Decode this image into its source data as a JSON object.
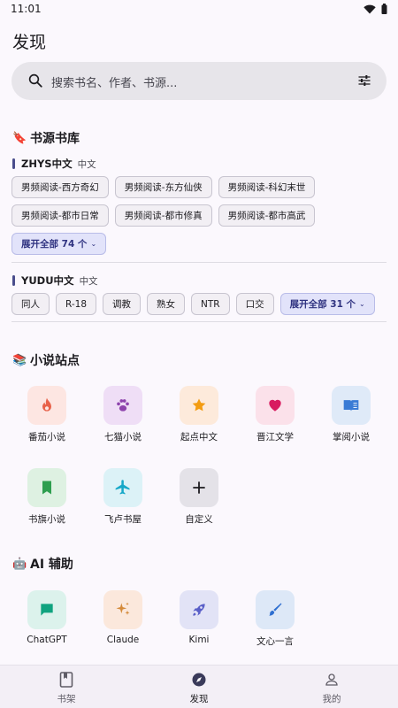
{
  "status": {
    "time": "11:01"
  },
  "page": {
    "title": "发现"
  },
  "search": {
    "placeholder": "搜索书名、作者、书源..."
  },
  "sections": {
    "sources": {
      "emoji": "🔖",
      "title": "书源书库"
    },
    "novels": {
      "emoji": "📚",
      "title": "小说站点"
    },
    "ai": {
      "emoji": "🤖",
      "title": "AI 辅助"
    }
  },
  "source_groups": [
    {
      "name": "ZHYS中文",
      "lang": "中文",
      "chips": [
        "男频阅读-西方奇幻",
        "男频阅读-东方仙侠",
        "男频阅读-科幻末世",
        "男频阅读-都市日常",
        "男频阅读-都市修真",
        "男频阅读-都市高武"
      ],
      "expand": "展开全部 74 个"
    },
    {
      "name": "YUDU中文",
      "lang": "中文",
      "chips": [
        "同人",
        "R-18",
        "调教",
        "熟女",
        "NTR",
        "口交"
      ],
      "expand": "展开全部 31 个"
    }
  ],
  "novel_sites": [
    {
      "label": "番茄小说",
      "icon": "flame-icon",
      "bg": "#fde6e2",
      "fg": "#e8624a"
    },
    {
      "label": "七猫小说",
      "icon": "paw-icon",
      "bg": "#efdef6",
      "fg": "#8e44ad"
    },
    {
      "label": "起点中文",
      "icon": "star-icon",
      "bg": "#fdeadb",
      "fg": "#f39c12"
    },
    {
      "label": "晋江文学",
      "icon": "heart-icon",
      "bg": "#fbe1ea",
      "fg": "#d81b60"
    },
    {
      "label": "掌阅小说",
      "icon": "book-open-icon",
      "bg": "#dfeaf8",
      "fg": "#3a7bd5"
    },
    {
      "label": "书旗小说",
      "icon": "bookmark-icon",
      "bg": "#def1e2",
      "fg": "#2e9e4f"
    },
    {
      "label": "飞卢书屋",
      "icon": "airplane-icon",
      "bg": "#dcf2f7",
      "fg": "#16a8c8"
    },
    {
      "label": "自定义",
      "icon": "plus-icon",
      "bg": "#e4e2e8",
      "fg": "#1c1b1f"
    }
  ],
  "ai_tools": [
    {
      "label": "ChatGPT",
      "icon": "chat-icon",
      "bg": "#dcf2ec",
      "fg": "#10a37f"
    },
    {
      "label": "Claude",
      "icon": "sparkle-icon",
      "bg": "#fbe8dc",
      "fg": "#d48a3a"
    },
    {
      "label": "Kimi",
      "icon": "rocket-icon",
      "bg": "#e2e3f6",
      "fg": "#5a5fc8"
    },
    {
      "label": "文心一言",
      "icon": "brush-icon",
      "bg": "#dde8f7",
      "fg": "#2f6fd0"
    }
  ],
  "nav": {
    "shelf": "书架",
    "discover": "发现",
    "mine": "我的"
  }
}
